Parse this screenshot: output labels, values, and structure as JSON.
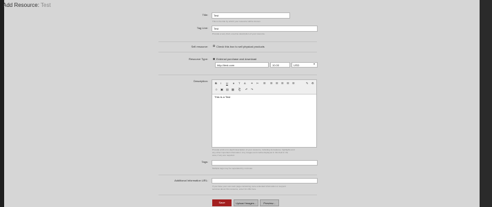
{
  "header": {
    "title": "Add Resource:",
    "title_name": "Test"
  },
  "form": {
    "title": {
      "label": "Title:",
      "value": "Test",
      "hint": "This is the title by which your resource will be known."
    },
    "tag_line": {
      "label": "Tag Line:",
      "value": "Test",
      "hint": "Provide a very brief, one-line description of your resource."
    },
    "sell": {
      "label": "Sell resource:",
      "checkbox_label": "Check this box to sell physical products"
    },
    "resource_type": {
      "label": "Resource Type:",
      "option": "External purchase and download",
      "url": "http://test.com",
      "price": "10.00",
      "currency": "USD"
    },
    "description": {
      "label": "Description:",
      "content": "This is a Test",
      "hint_line1": "Provide a full or in-depth description of your resource, including its features, highlights and",
      "hint_line2": "any other important information. Any images and media displayed in this field in the",
      "hint_line3": "area, if any are required."
    },
    "tags": {
      "label": "Tags:",
      "hint": "Multiple tags may be separated by commas."
    },
    "additional_url": {
      "label": "Additional Information URL:",
      "hint_line1": "If you have your own web page containing more extended information or support",
      "hint_line2": "services about this resource, enter its URL here."
    }
  },
  "toolbar": {
    "row1": [
      "B",
      "I",
      "U",
      "♦",
      "T",
      "A",
      "⚭",
      "✂",
      "☰",
      "☰",
      "☰",
      "☰",
      "☰",
      "☰"
    ],
    "row2": [
      "☺",
      "▣",
      "▤",
      "▦",
      "⎗",
      "↶",
      "↷"
    ],
    "right": [
      "✎",
      "⚙"
    ]
  },
  "buttons": {
    "save": "Save",
    "upload": "Upload Images...",
    "preview": "Preview..."
  }
}
